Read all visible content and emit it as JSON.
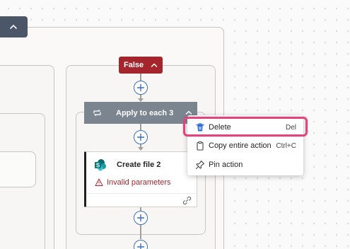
{
  "condition": {
    "false_label": "False"
  },
  "apply_each": {
    "label": "Apply to each 3"
  },
  "action_card": {
    "title": "Create file 2",
    "status": "Invalid parameters"
  },
  "context_menu": {
    "items": [
      {
        "label": "Delete",
        "shortcut": "Del",
        "icon": "trash-icon"
      },
      {
        "label": "Copy entire action",
        "shortcut": "Ctrl+C",
        "icon": "clipboard-icon"
      },
      {
        "label": "Pin action",
        "shortcut": "",
        "icon": "pin-icon"
      }
    ]
  },
  "colors": {
    "false_branch": "#a4262c",
    "apply_bar": "#7b8590",
    "header": "#4b5768",
    "menu_highlight": "#e0457b",
    "delete_icon": "#2f6fd1",
    "error_text": "#a4262c"
  }
}
